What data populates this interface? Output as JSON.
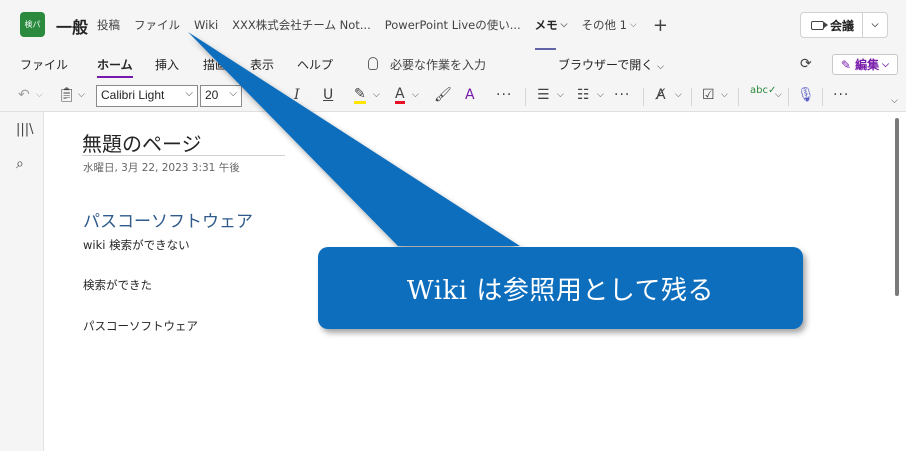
{
  "header": {
    "team_avatar": "検パ",
    "channel": "一般",
    "tabs": [
      {
        "label": "投稿",
        "active": false
      },
      {
        "label": "ファイル",
        "active": false
      },
      {
        "label": "Wiki",
        "active": false
      },
      {
        "label": "XXX株式会社チーム Not...",
        "active": false
      },
      {
        "label": "PowerPoint Liveの使い...",
        "active": false
      },
      {
        "label": "メモ",
        "active": true
      },
      {
        "label": "その他 1",
        "active": false
      }
    ],
    "meeting_label": "会議"
  },
  "ribbon": {
    "tabs": [
      "ファイル",
      "ホーム",
      "挿入",
      "描画",
      "表示",
      "ヘルプ"
    ],
    "search_hint": "必要な作業を入力",
    "open_in_browser": "ブラウザーで開く",
    "edit_label": "編集"
  },
  "toolbar": {
    "font_name": "Calibri Light",
    "font_size": "20"
  },
  "page": {
    "title": "無題のページ",
    "date": "水曜日, 3月 22, 2023    3:31 午後",
    "heading": "パスコーソフトウェア",
    "lines": [
      "wiki 検索ができない",
      "検索ができた",
      "パスコーソフトウェア"
    ]
  },
  "callout": {
    "text": "Wiki は参照用として残る",
    "color": "#0a6ebd"
  }
}
